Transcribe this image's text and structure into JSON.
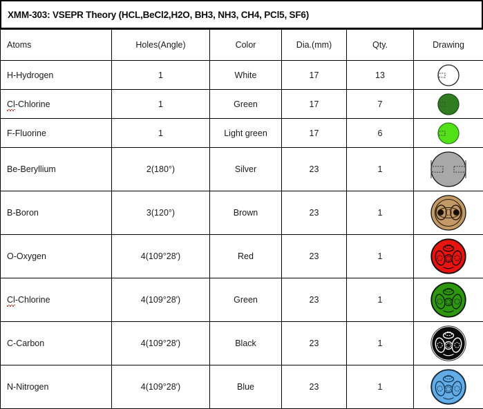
{
  "title": "XMM-303: VSEPR Theory (HCL,BeCl2,H2O, BH3, NH3, CH4, PCl5, SF6)",
  "table": {
    "headers": {
      "atoms": "Atoms",
      "holes": "Holes(Angle)",
      "color": "Color",
      "dia": "Dia.(mm)",
      "qty": "Qty.",
      "drawing": "Drawing"
    },
    "rows": [
      {
        "atom": "H-Hydrogen",
        "atom_prefix": "H",
        "atom_rest": "-Hydrogen",
        "misspelled": false,
        "holes": "1",
        "color": "White",
        "dia": "17",
        "qty": "13",
        "drawing": {
          "icon": "sphere-1-hole-white-icon",
          "fill": "#ffffff",
          "stroke": "#222222",
          "holes": 1
        }
      },
      {
        "atom": "Cl-Chlorine",
        "atom_prefix": "Cl",
        "atom_rest": "-Chlorine",
        "misspelled": true,
        "holes": "1",
        "color": "Green",
        "dia": "17",
        "qty": "7",
        "drawing": {
          "icon": "sphere-1-hole-green-icon",
          "fill": "#2f7d20",
          "stroke": "#1d4c14",
          "holes": 1
        }
      },
      {
        "atom": "F-Fluorine",
        "atom_prefix": "F",
        "atom_rest": "-Fluorine",
        "misspelled": false,
        "holes": "1",
        "color": "Light green",
        "dia": "17",
        "qty": "6",
        "drawing": {
          "icon": "sphere-1-hole-lightgreen-icon",
          "fill": "#52e017",
          "stroke": "#2f7d20",
          "holes": 1
        }
      },
      {
        "atom": "Be-Beryllium",
        "atom_prefix": "Be",
        "atom_rest": "-Beryllium",
        "misspelled": false,
        "holes": "2(180°)",
        "color": "Silver",
        "dia": "23",
        "qty": "1",
        "drawing": {
          "icon": "sphere-2-hole-silver-icon",
          "fill": "#a8a8a8",
          "stroke": "#4a4a4a",
          "holes": 2
        }
      },
      {
        "atom": "B-Boron",
        "atom_prefix": "B",
        "atom_rest": "-Boron",
        "misspelled": false,
        "holes": "3(120°)",
        "color": "Brown",
        "dia": "23",
        "qty": "1",
        "drawing": {
          "icon": "sphere-3-hole-brown-icon",
          "fill": "#c39a66",
          "stroke": "#2a1c0e",
          "holes": 3
        }
      },
      {
        "atom": "O-Oxygen",
        "atom_prefix": "O",
        "atom_rest": "-Oxygen",
        "misspelled": false,
        "holes": "4(109°28′)",
        "color": "Red",
        "dia": "23",
        "qty": "1",
        "drawing": {
          "icon": "sphere-4-hole-red-icon",
          "fill": "#e8140f",
          "stroke": "#1a0100",
          "holes": 4
        }
      },
      {
        "atom": "Cl-Chlorine",
        "atom_prefix": "Cl",
        "atom_rest": "-Chlorine",
        "misspelled": true,
        "holes": "4(109°28′)",
        "color": "Green",
        "dia": "23",
        "qty": "1",
        "drawing": {
          "icon": "sphere-4-hole-green-icon",
          "fill": "#2f9610",
          "stroke": "#07240a",
          "holes": 4
        }
      },
      {
        "atom": "C-Carbon",
        "atom_prefix": "C",
        "atom_rest": "-Carbon",
        "misspelled": false,
        "holes": "4(109°28′)",
        "color": "Black",
        "dia": "23",
        "qty": "1",
        "drawing": {
          "icon": "sphere-4-hole-black-icon",
          "fill": "#0a0a0a",
          "stroke": "#ffffff",
          "holes": 4
        }
      },
      {
        "atom": "N-Nitrogen",
        "atom_prefix": "N",
        "atom_rest": "-Nitrogen",
        "misspelled": false,
        "holes": "4(109°28′)",
        "color": "Blue",
        "dia": "23",
        "qty": "1",
        "drawing": {
          "icon": "sphere-4-hole-blue-icon",
          "fill": "#63ace5",
          "stroke": "#123a5c",
          "holes": 4
        }
      }
    ]
  }
}
